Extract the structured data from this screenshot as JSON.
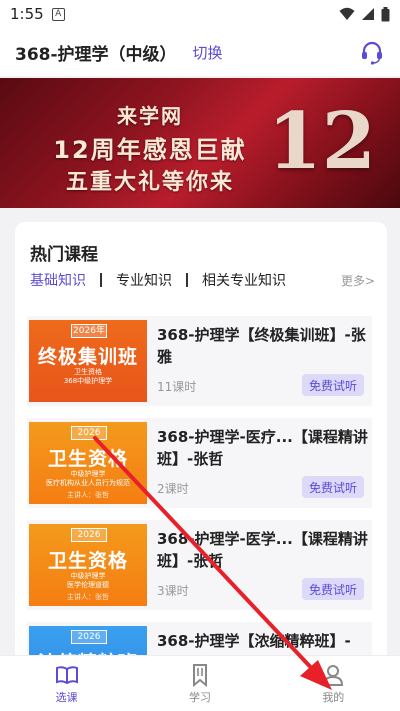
{
  "status_bar": {
    "time": "1:55",
    "notif_letter": "A"
  },
  "header": {
    "title": "368-护理学（中级）",
    "switch_label": "切换",
    "support_icon": "headset-icon"
  },
  "banner": {
    "line1": "来学网",
    "line2": "12周年感恩巨献",
    "line3": "五重大礼等你来",
    "number": "12"
  },
  "courses": {
    "section_title": "热门课程",
    "tabs": [
      {
        "label": "基础知识",
        "active": true
      },
      {
        "label": "专业知识",
        "active": false
      },
      {
        "label": "相关专业知识",
        "active": false
      }
    ],
    "more_label": "更多>",
    "items": [
      {
        "title": "368-护理学【终极集训班】-张雅",
        "lessons": "11课时",
        "trial_label": "免费试听",
        "thumb": {
          "year": "2026年",
          "big": "终极集训班",
          "small1": "卫生资格",
          "small2": "368中级护理学",
          "teacher": ""
        }
      },
      {
        "title": "368-护理学-医疗...【课程精讲班】-张哲",
        "lessons": "2课时",
        "trial_label": "免费试听",
        "thumb": {
          "year": "2026",
          "big": "卫生资格",
          "small1": "中级护理学",
          "small2": "医疗机构从业人员行为规范",
          "teacher": "主讲人：张哲"
        }
      },
      {
        "title": "368-护理学-医学...【课程精讲班】-张哲",
        "lessons": "3课时",
        "trial_label": "免费试听",
        "thumb": {
          "year": "2026",
          "big": "卫生资格",
          "small1": "中级护理学",
          "small2": "医学伦理道德",
          "teacher": "主讲人：张哲"
        }
      },
      {
        "title": "368-护理学【浓缩精粹班】-",
        "lessons": "",
        "trial_label": "",
        "thumb": {
          "year": "2026",
          "big": "浓缩精粹班",
          "small1": "",
          "small2": "",
          "teacher": ""
        }
      }
    ]
  },
  "bottom_nav": [
    {
      "label": "选课",
      "icon": "book-open-icon",
      "active": true
    },
    {
      "label": "学习",
      "icon": "bookmark-icon",
      "active": false
    },
    {
      "label": "我的",
      "icon": "user-icon",
      "active": false
    }
  ],
  "colors": {
    "accent": "#5b4cd6",
    "arrow": "#e8202a"
  }
}
